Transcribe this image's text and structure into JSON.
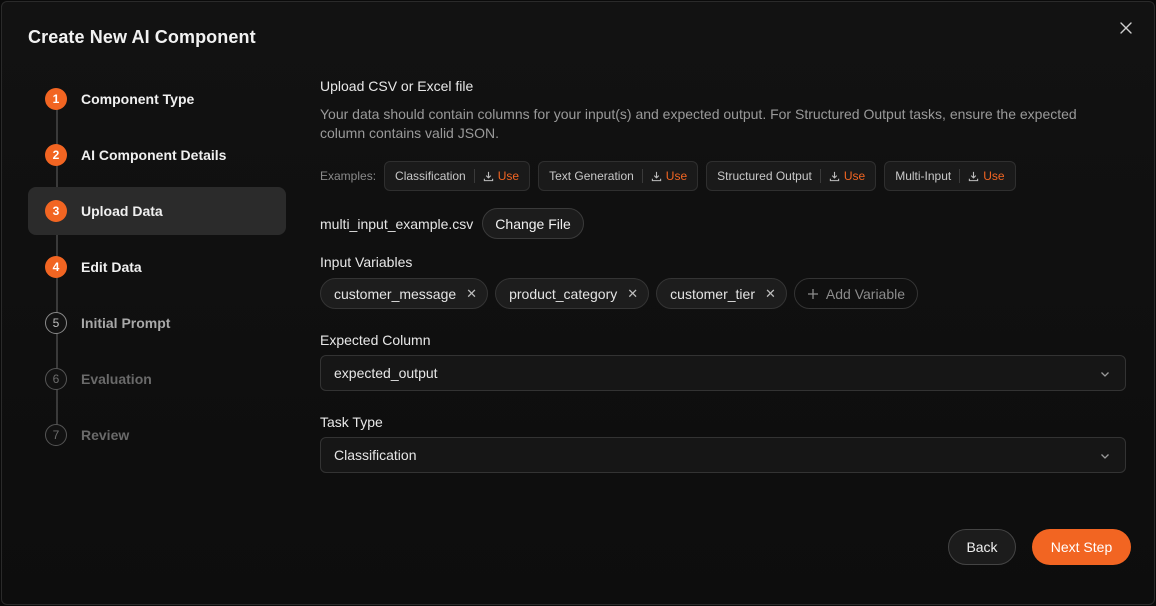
{
  "dialog": {
    "title": "Create New AI Component"
  },
  "steps": [
    {
      "num": "1",
      "label": "Component Type",
      "state": "done"
    },
    {
      "num": "2",
      "label": "AI Component Details",
      "state": "done"
    },
    {
      "num": "3",
      "label": "Upload Data",
      "state": "current"
    },
    {
      "num": "4",
      "label": "Edit Data",
      "state": "done"
    },
    {
      "num": "5",
      "label": "Initial Prompt",
      "state": "todo"
    },
    {
      "num": "6",
      "label": "Evaluation",
      "state": "disabled"
    },
    {
      "num": "7",
      "label": "Review",
      "state": "disabled"
    }
  ],
  "upload": {
    "title": "Upload CSV or Excel file",
    "description": "Your data should contain columns for your input(s) and expected output. For Structured Output tasks, ensure the expected column contains valid JSON.",
    "examples_label": "Examples:",
    "examples": [
      {
        "name": "Classification",
        "use": "Use"
      },
      {
        "name": "Text Generation",
        "use": "Use"
      },
      {
        "name": "Structured Output",
        "use": "Use"
      },
      {
        "name": "Multi-Input",
        "use": "Use"
      }
    ],
    "file_name": "multi_input_example.csv",
    "change_file": "Change File"
  },
  "input_variables": {
    "label": "Input Variables",
    "items": [
      "customer_message",
      "product_category",
      "customer_tier"
    ],
    "add_label": "Add Variable"
  },
  "expected_column": {
    "label": "Expected Column",
    "value": "expected_output"
  },
  "task_type": {
    "label": "Task Type",
    "value": "Classification"
  },
  "footer": {
    "back": "Back",
    "next": "Next Step"
  },
  "colors": {
    "accent": "#f26522",
    "background": "#0d0d0d"
  }
}
